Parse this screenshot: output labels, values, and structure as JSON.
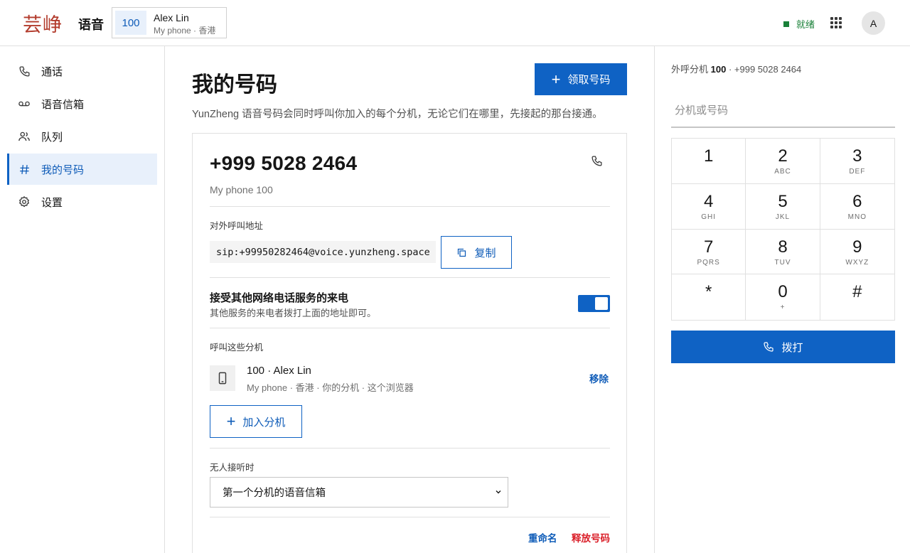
{
  "header": {
    "logo_text": "芸峥",
    "product": "语音",
    "account": {
      "extension": "100",
      "name": "Alex Lin",
      "subtitle": "My phone · 香港"
    },
    "status": {
      "label": "就绪",
      "color": "#198038"
    },
    "apps_icon": "grid-icon",
    "avatar_initial": "A"
  },
  "sidebar": {
    "items": [
      {
        "label": "通话",
        "icon": "phone-icon",
        "active": false
      },
      {
        "label": "语音信箱",
        "icon": "voicemail-icon",
        "active": false
      },
      {
        "label": "队列",
        "icon": "users-icon",
        "active": false
      },
      {
        "label": "我的号码",
        "icon": "hash-icon",
        "active": true
      },
      {
        "label": "设置",
        "icon": "gear-icon",
        "active": false
      }
    ]
  },
  "main": {
    "title": "我的号码",
    "claim_button": "领取号码",
    "description": "YunZheng 语音号码会同时呼叫你加入的每个分机，无论它们在哪里，先接起的那台接通。",
    "card": {
      "number": "+999 5028 2464",
      "number_subtitle": "My phone 100",
      "outbound_label": "对外呼叫地址",
      "sip_address": "sip:+99950282464@voice.yunzheng.space",
      "copy_button": "复制",
      "accept_title": "接受其他网络电话服务的来电",
      "accept_subtitle": "其他服务的来电者拨打上面的地址即可。",
      "accept_enabled": true,
      "ring_label": "呼叫这些分机",
      "extension": {
        "title": "100 · Alex Lin",
        "subtitle": "My phone · 香港 · 你的分机 · 这个浏览器",
        "remove": "移除"
      },
      "add_extension_button": "加入分机",
      "no_answer_label": "无人接听时",
      "no_answer_value": "第一个分机的语音信箱",
      "rename": "重命名",
      "release": "释放号码"
    }
  },
  "dialer": {
    "caller_prefix": "外呼分机",
    "caller_ext": "100",
    "caller_suffix": "· +999 5028 2464",
    "input_placeholder": "分机或号码",
    "keys": [
      {
        "digit": "1",
        "letters": ""
      },
      {
        "digit": "2",
        "letters": "ABC"
      },
      {
        "digit": "3",
        "letters": "DEF"
      },
      {
        "digit": "4",
        "letters": "GHI"
      },
      {
        "digit": "5",
        "letters": "JKL"
      },
      {
        "digit": "6",
        "letters": "MNO"
      },
      {
        "digit": "7",
        "letters": "PQRS"
      },
      {
        "digit": "8",
        "letters": "TUV"
      },
      {
        "digit": "9",
        "letters": "WXYZ"
      },
      {
        "digit": "*",
        "letters": ""
      },
      {
        "digit": "0",
        "letters": "+"
      },
      {
        "digit": "#",
        "letters": ""
      }
    ],
    "dial_button": "拨打"
  },
  "colors": {
    "accent": "#0f62c4",
    "danger": "#da1e28",
    "active_bg": "#e8f0fb"
  }
}
